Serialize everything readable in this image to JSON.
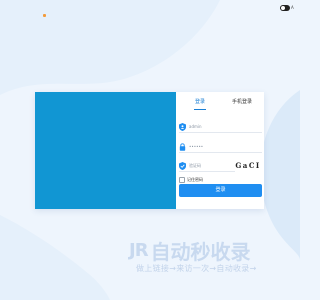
{
  "theme_toggle": {
    "label": "A",
    "icon": "toggle-icon"
  },
  "login": {
    "tabs": [
      {
        "label": "登录",
        "active": true
      },
      {
        "label": "手机登录",
        "active": false
      }
    ],
    "username": {
      "value": "admin",
      "icon": "user-shield-icon"
    },
    "password": {
      "value": "••••••",
      "icon": "lock-icon"
    },
    "captcha_input": {
      "placeholder": "验证码",
      "icon": "shield-check-icon"
    },
    "captcha_code": "GaCI",
    "remember_label": "记住密码",
    "submit_label": "登录"
  },
  "watermark": {
    "brand": "JR",
    "name": "自动秒收录",
    "slogan": "做上链接→来访一次→自动收录→"
  },
  "colors": {
    "background": "#eef5fd",
    "left_panel": "#1196d3",
    "accent": "#1f8ef1",
    "tab_active": "#1a7fd4",
    "watermark": "#c8d9ef"
  }
}
